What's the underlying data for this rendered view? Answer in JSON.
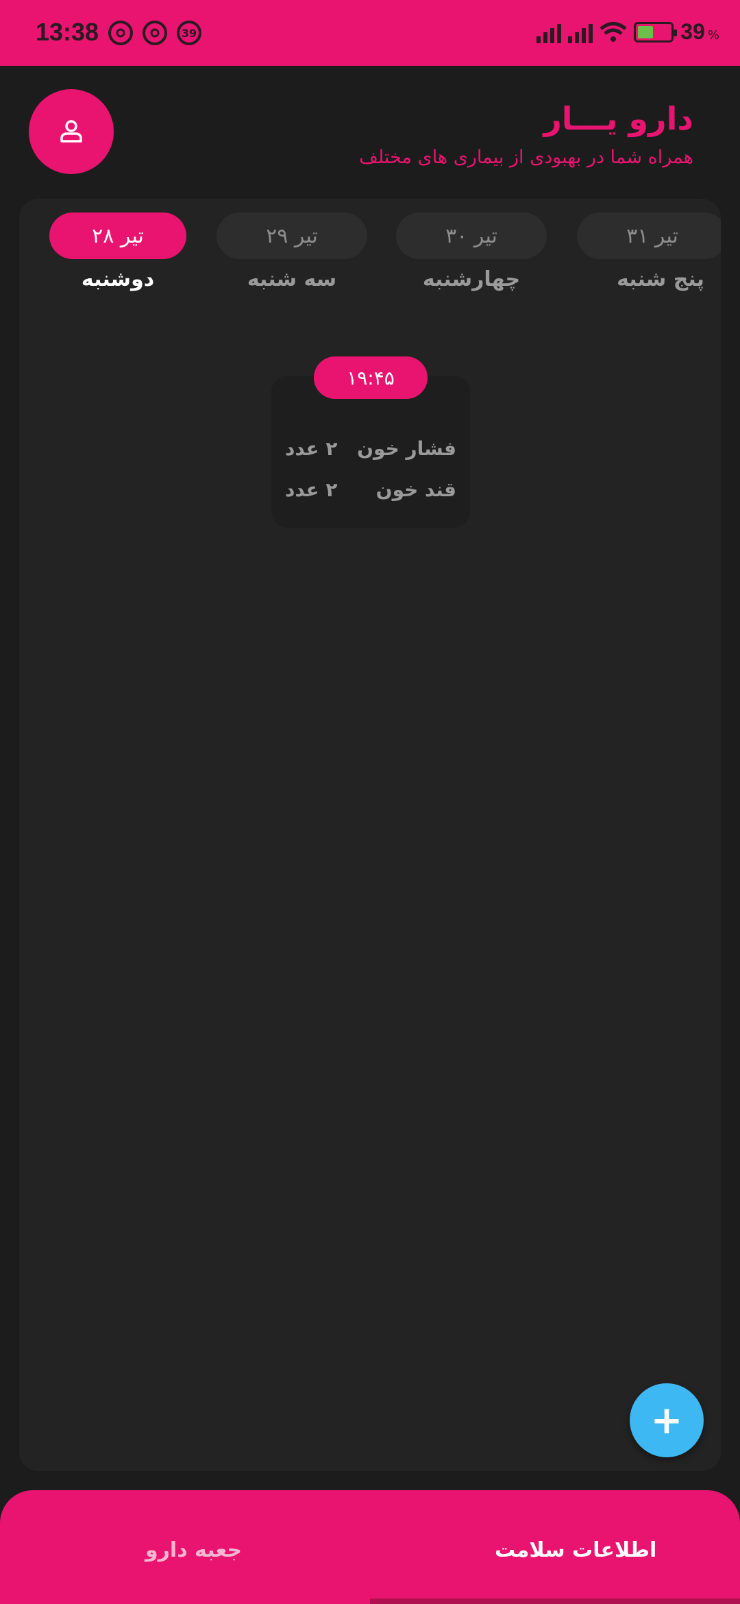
{
  "status_bar": {
    "time": "13:38",
    "notif_badge": "39",
    "battery_level": "39",
    "battery_unit": "%"
  },
  "header": {
    "title": "دارو یـــار",
    "subtitle": "همراه شما در بهبودی از بیماری های مختلف",
    "profile_icon": "user-icon"
  },
  "days": [
    {
      "date": "تیر ۳۱",
      "name": "پنج شنبه",
      "active": false
    },
    {
      "date": "تیر ۳۰",
      "name": "چهارشنبه",
      "active": false
    },
    {
      "date": "تیر ۲۹",
      "name": "سه شنبه",
      "active": false
    },
    {
      "date": "تیر ۲۸",
      "name": "دوشنبه",
      "active": true
    }
  ],
  "dose": {
    "time": "۱۹:۴۵",
    "items": [
      {
        "name": "فشار خون",
        "qty": "۲ عدد"
      },
      {
        "name": "قند خون",
        "qty": "۲ عدد"
      }
    ]
  },
  "fab": {
    "label": "+"
  },
  "bottom_nav": {
    "health": "اطلاعات سلامت",
    "medicine_box": "جعبه دارو"
  },
  "colors": {
    "accent": "#e91470",
    "fab": "#3eb8f2",
    "background": "#1c1c1c",
    "card": "#232323"
  }
}
